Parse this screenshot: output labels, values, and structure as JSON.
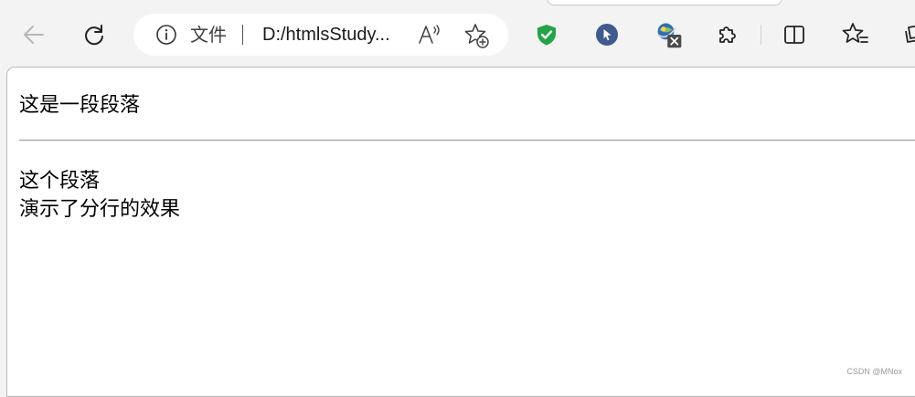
{
  "browser": {
    "omnibox": {
      "scheme_label": "文件",
      "url": "D:/htmlsStudy..."
    }
  },
  "page": {
    "paragraph1": "这是一段段落",
    "paragraph2_line1": "这个段落",
    "paragraph2_line2": "演示了分行的效果"
  },
  "watermark": "CSDN @MNox",
  "colors": {
    "toolbar_bg": "#f3f3f3",
    "page_bg": "#ffffff",
    "shield_green": "#22a447",
    "cursor_badge": "#3f5a8c"
  }
}
